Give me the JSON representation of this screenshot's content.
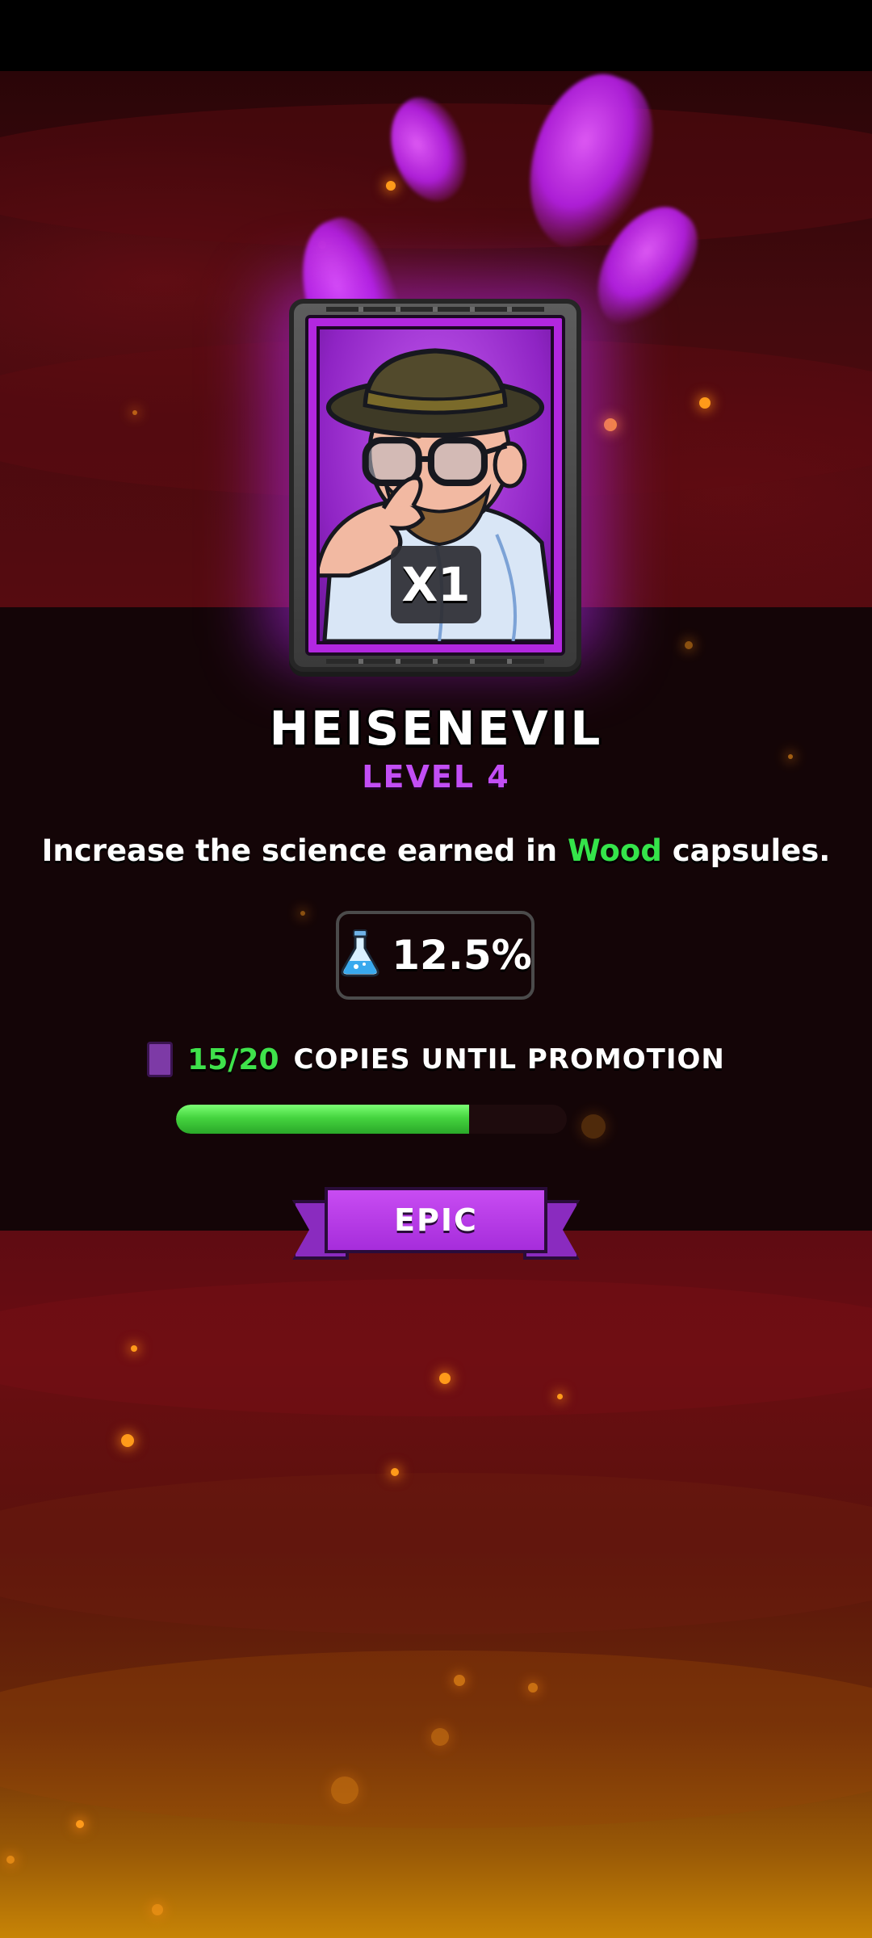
{
  "card": {
    "count_badge": "X1",
    "name": "HEISENEVIL",
    "level": "LEVEL 4",
    "rarity": "EPIC"
  },
  "description": {
    "prefix": "Increase the science earned in ",
    "highlight": "Wood",
    "suffix": " capsules."
  },
  "stat": {
    "icon": "flask-icon",
    "value": "12.5%"
  },
  "promotion": {
    "icon": "card-icon",
    "count": "15/20",
    "label": "COPIES UNTIL PROMOTION",
    "progress": 0.75
  },
  "colors": {
    "accent_purple": "#b227e0",
    "level_purple": "#c24ef5",
    "highlight_green": "#35e44a",
    "progress_green": "#45d43f"
  }
}
